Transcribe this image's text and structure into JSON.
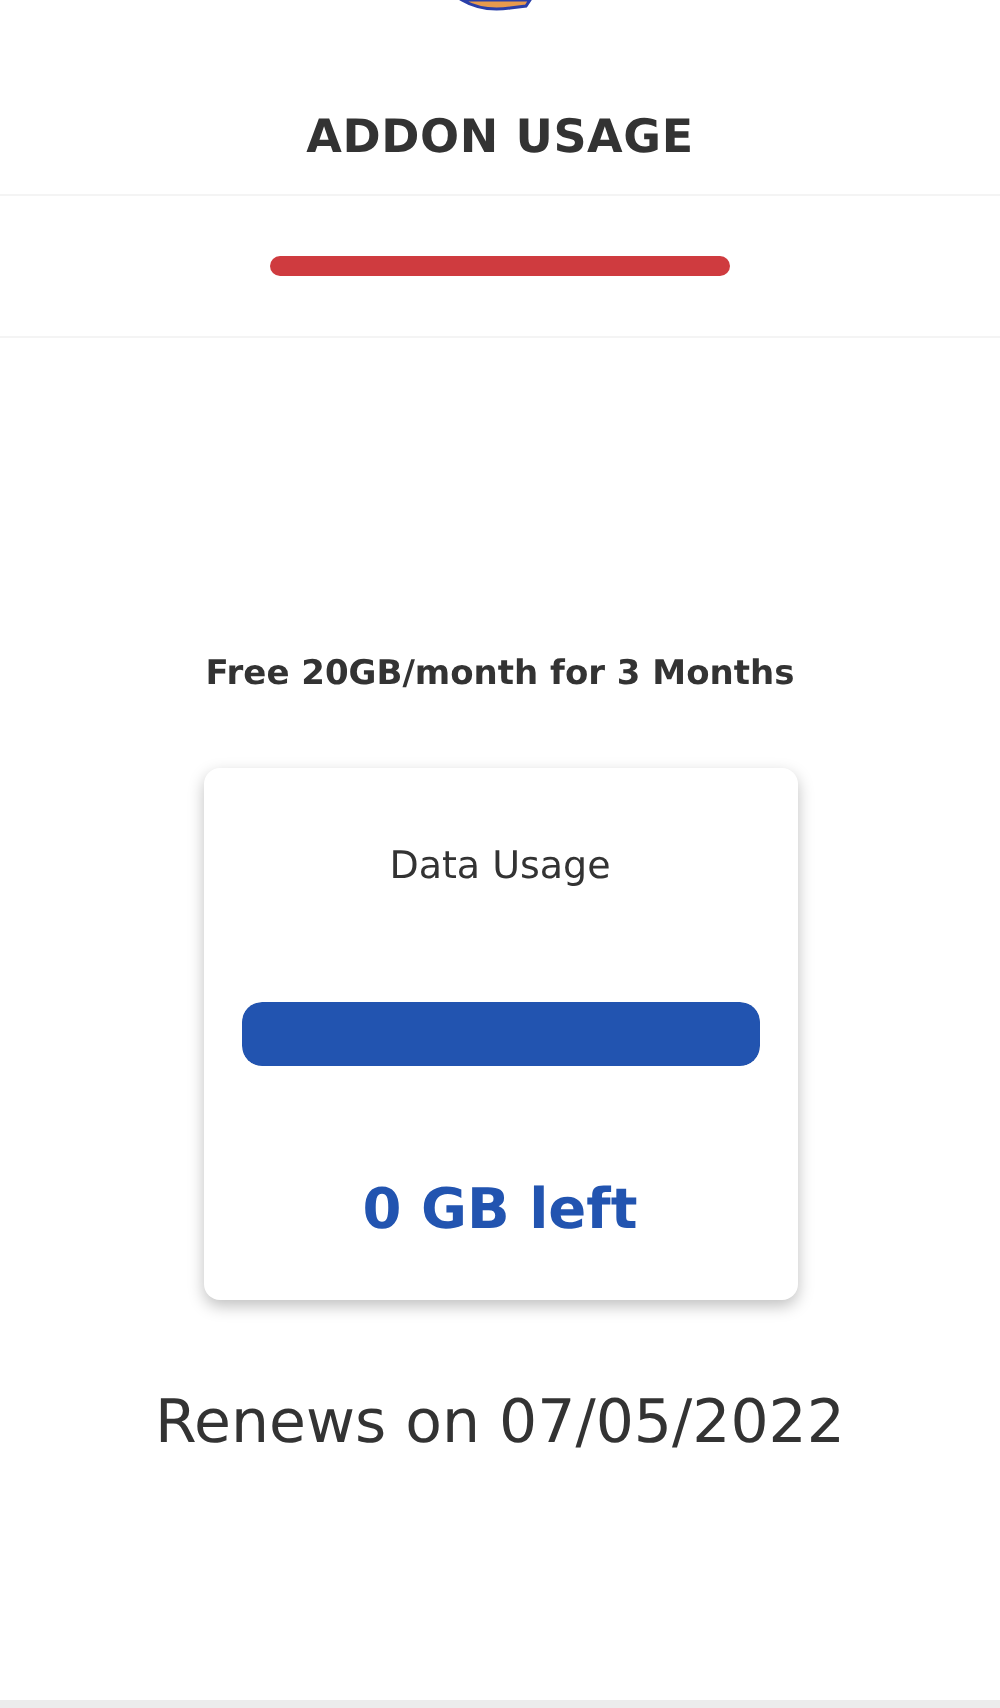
{
  "header": {
    "title": "ADDON USAGE"
  },
  "plan": {
    "name": "Free 20GB/month for 3 Months"
  },
  "usage_card": {
    "label": "Data Usage",
    "level": 1,
    "remaining": "0 GB left"
  },
  "renewal": "Renews on 07/05/2022"
}
